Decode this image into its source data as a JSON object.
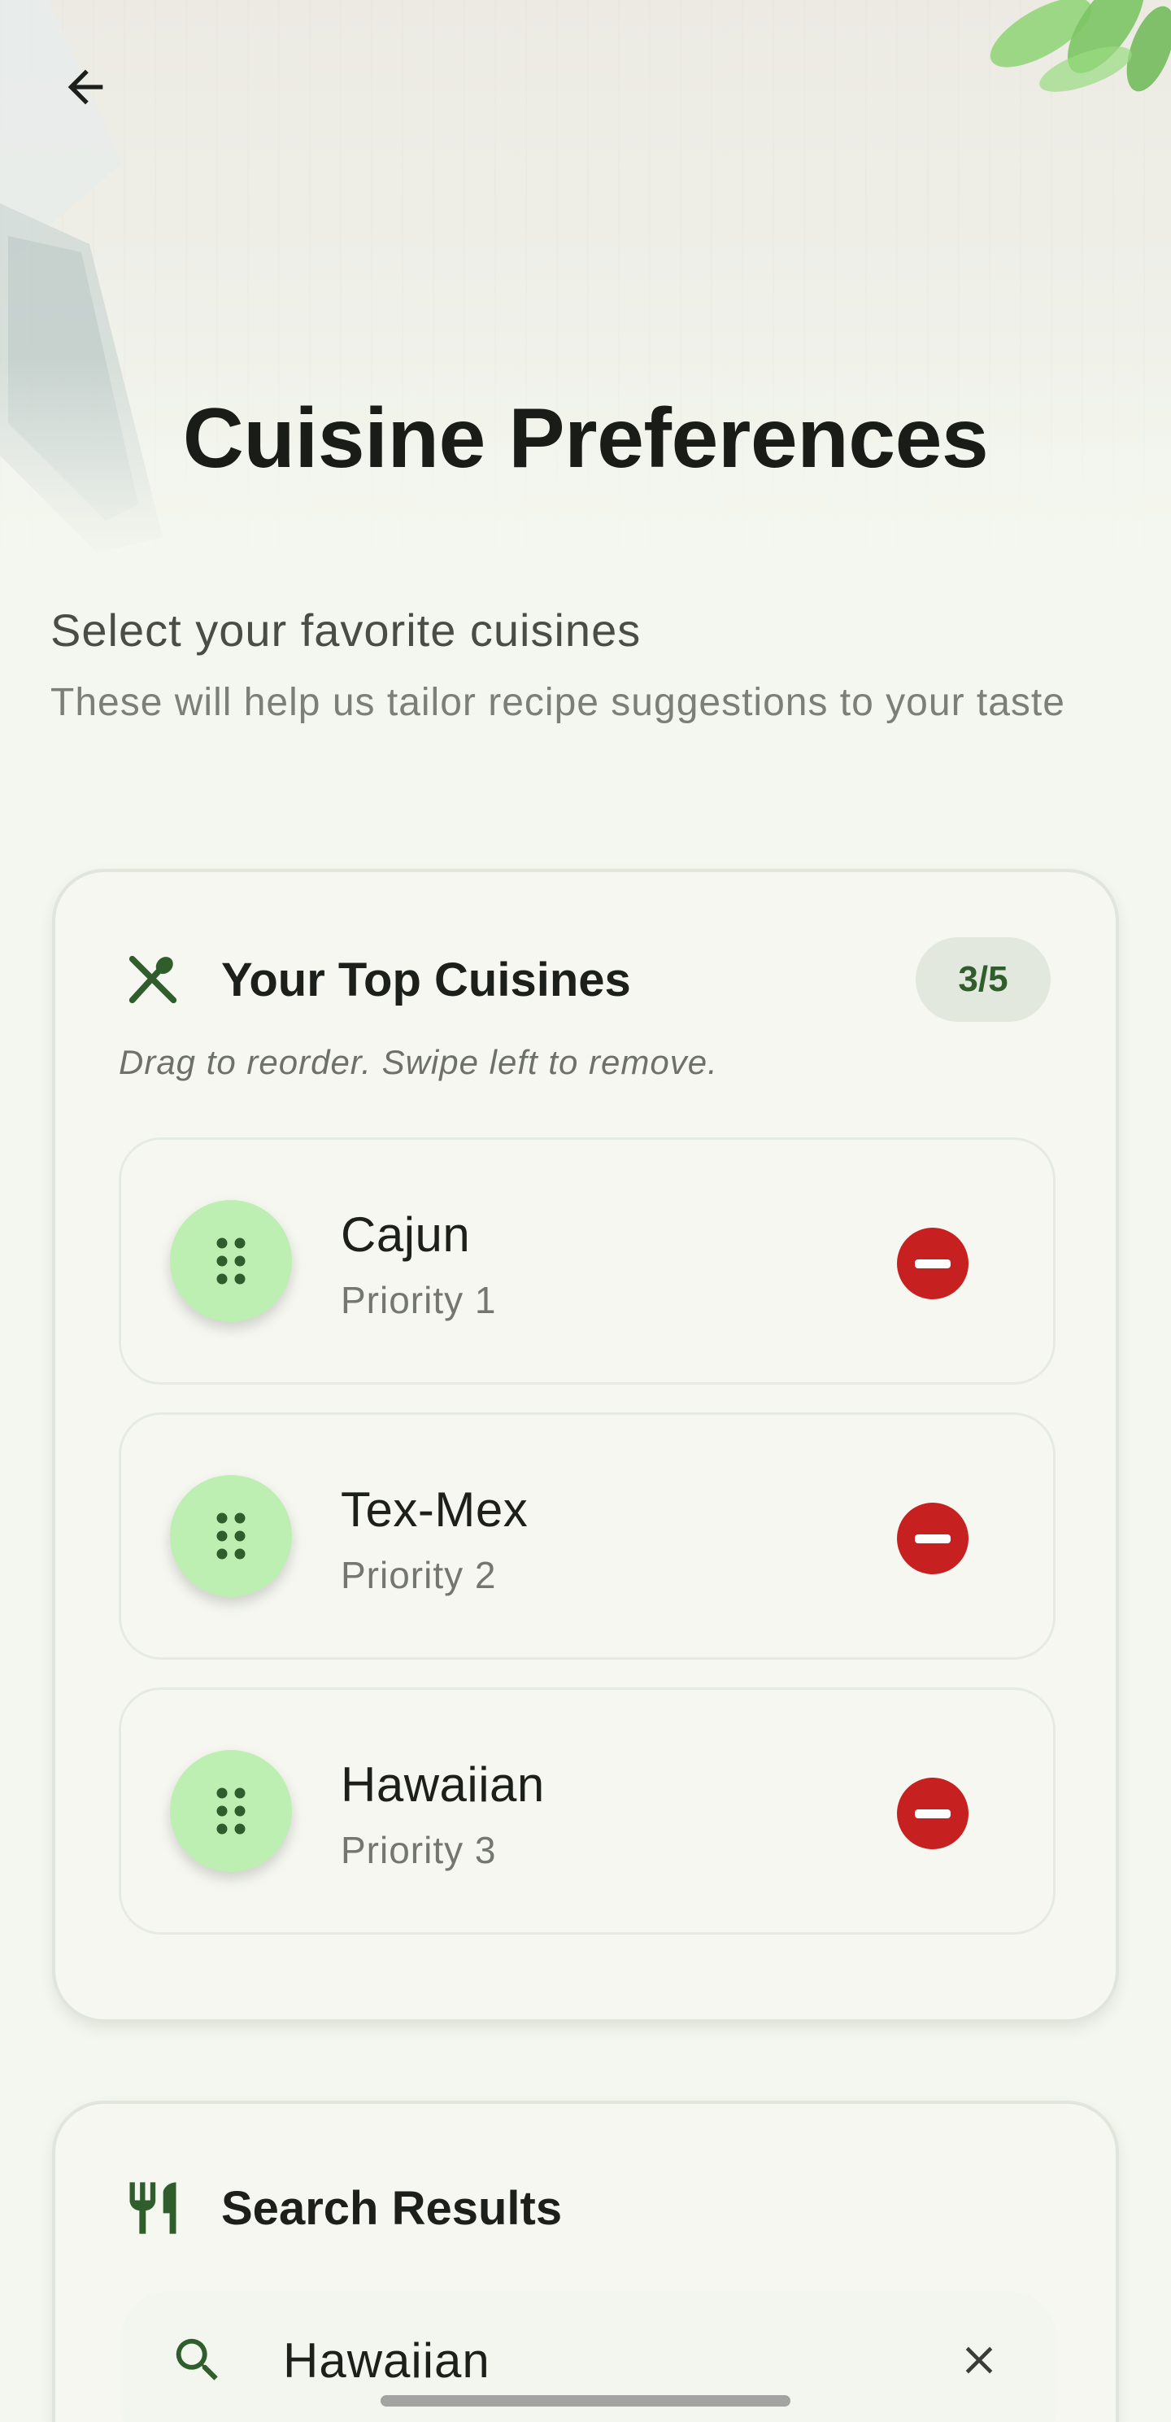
{
  "header": {
    "title": "Cuisine Preferences",
    "back_icon": "arrow-left-icon"
  },
  "intro": {
    "title": "Select your favorite cuisines",
    "subtitle": "These will help us tailor recipe suggestions to your taste"
  },
  "top_cuisines": {
    "title": "Your Top Cuisines",
    "icon": "fork-spoon-crossed-icon",
    "count": "3/5",
    "hint": "Drag to reorder. Swipe left to remove.",
    "items": [
      {
        "name": "Cajun",
        "priority": "Priority 1"
      },
      {
        "name": "Tex-Mex",
        "priority": "Priority 2"
      },
      {
        "name": "Hawaiian",
        "priority": "Priority 3"
      }
    ]
  },
  "search_results": {
    "title": "Search Results",
    "icon": "restaurant-icon",
    "search_value": "Hawaiian"
  },
  "colors": {
    "background": "#f4f7ef",
    "accent_green": "#2f5d2b",
    "handle_green": "#bdefb2",
    "remove_red": "#c62020"
  }
}
